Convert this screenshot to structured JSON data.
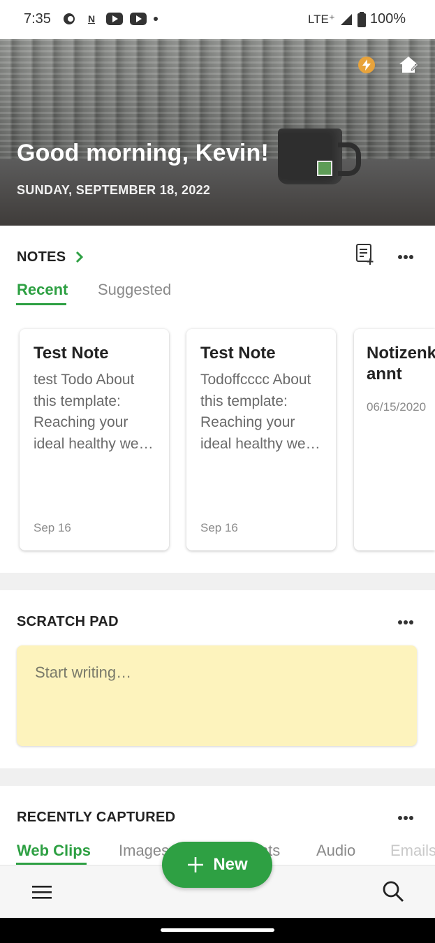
{
  "status_bar": {
    "time": "7:35",
    "network": "LTE⁺",
    "battery": "100%"
  },
  "hero": {
    "greeting": "Good morning, Kevin!",
    "date": "SUNDAY, SEPTEMBER 18, 2022"
  },
  "notes": {
    "title": "NOTES",
    "tabs": [
      {
        "label": "Recent",
        "active": true
      },
      {
        "label": "Suggested",
        "active": false
      }
    ],
    "cards": [
      {
        "title": "Test Note",
        "body": "test Todo About this template: Reaching your ideal healthy we…",
        "date": "Sep 16"
      },
      {
        "title": "Test Note",
        "body": "Todoffcccc About this template: Reaching your ideal healthy we…",
        "date": "Sep 16"
      },
      {
        "title": "Notizenkt Unbenannt",
        "body": "",
        "date": "06/15/2020"
      }
    ]
  },
  "scratch_pad": {
    "title": "SCRATCH PAD",
    "placeholder": "Start writing…"
  },
  "recently_captured": {
    "title": "RECENTLY CAPTURED",
    "tabs": [
      {
        "label": "Web Clips",
        "active": true
      },
      {
        "label": "Images",
        "active": false
      },
      {
        "label": "Documents",
        "active": false
      },
      {
        "label": "Audio",
        "active": false
      },
      {
        "label": "Emails",
        "active": false
      }
    ]
  },
  "fab": {
    "label": "New"
  },
  "colors": {
    "accent": "#2ea043",
    "scratch_bg": "#fdf3bd",
    "bolt": "#e8a33b"
  }
}
